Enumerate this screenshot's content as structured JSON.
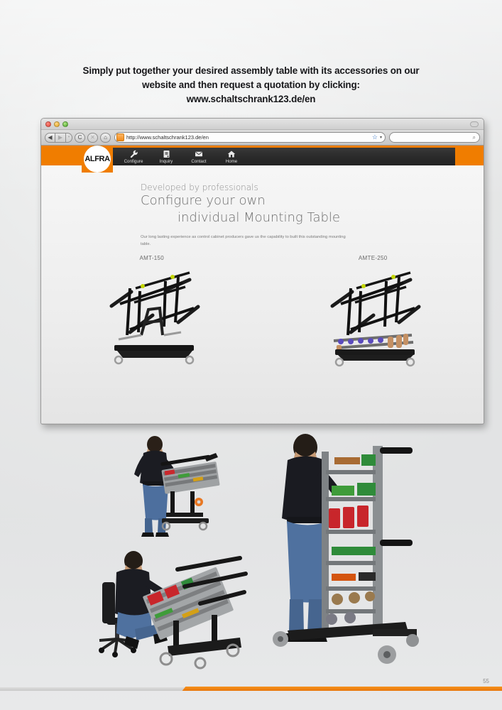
{
  "page": {
    "intro_line1": "Simply put together your desired assembly table with its accessories on our",
    "intro_line2": "website and then request a quotation by clicking:",
    "intro_line3": "www.schaltschrank123.de/en",
    "page_number": "55",
    "accent_color": "#f07d00",
    "background_color": "#e6e7e8"
  },
  "browser": {
    "window_controls": {
      "close": "close-button",
      "minimize": "minimize-button",
      "zoom": "zoom-button"
    },
    "toolbar": {
      "back_label": "◀",
      "forward_label": "▶",
      "history_label": "▾",
      "reload_label": "C",
      "stop_label": "✕",
      "home_label": "⌂",
      "favicon_label": "▣",
      "url_value": "http://www.schaltschrank123.de/en",
      "url_placeholder": "Enter address",
      "bookmark_label": "☆",
      "bookmark_caret": "▾",
      "search_placeholder": "",
      "search_value": "",
      "search_icon_label": "⌕"
    }
  },
  "site": {
    "logo_text": "ALFRA",
    "nav": [
      {
        "label": "Configure",
        "icon": "wrench-icon"
      },
      {
        "label": "Inquiry",
        "icon": "document-arrow-icon"
      },
      {
        "label": "Contact",
        "icon": "envelope-icon"
      },
      {
        "label": "Home",
        "icon": "house-icon"
      }
    ],
    "hero": {
      "eyebrow": "Developed by professionals",
      "headline_line1": "Configure your own",
      "headline_line2": "individual Mounting Table",
      "paragraph": "Our long lasting experience as control cabinet producers gave us the capability to built this outstanding mounting table."
    },
    "products": [
      {
        "label": "AMT-150",
        "image": "mounting-table-black"
      },
      {
        "label": "AMTE-250",
        "image": "mounting-table-with-accessories"
      }
    ]
  },
  "photos": [
    {
      "name": "photo-technician-standing-at-table",
      "caption": ""
    },
    {
      "name": "photo-technician-at-vertical-rack",
      "caption": ""
    },
    {
      "name": "photo-technician-seated-at-table",
      "caption": ""
    }
  ]
}
